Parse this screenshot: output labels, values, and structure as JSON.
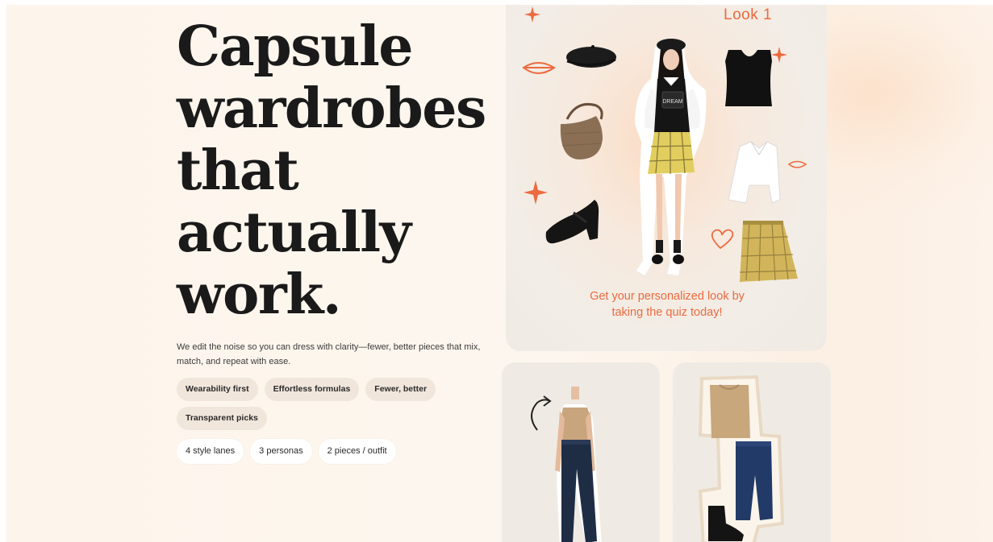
{
  "hero": {
    "title_lines": [
      "Capsule",
      "wardrobes",
      "that",
      "actually",
      "work."
    ],
    "subtitle": "We edit the noise so you can dress with clarity—fewer, better pieces that mix, match, and repeat with ease."
  },
  "tags": [
    "Wearability first",
    "Effortless formulas",
    "Fewer, better",
    "Transparent picks"
  ],
  "stats": [
    "4 style lanes",
    "3 personas",
    "2 pieces / outfit"
  ],
  "look_card": {
    "label": "Look 1",
    "promo_lines": [
      "Get your personalized look by",
      "taking the quiz today!"
    ],
    "shirt_text": "DREAM"
  },
  "colors": {
    "accent": "#ec6a3f",
    "text": "#1a1a1a",
    "tag_bg": "#f1e6dc",
    "card_bg": "#efebe4",
    "page_bg": "#fdf5ec"
  }
}
